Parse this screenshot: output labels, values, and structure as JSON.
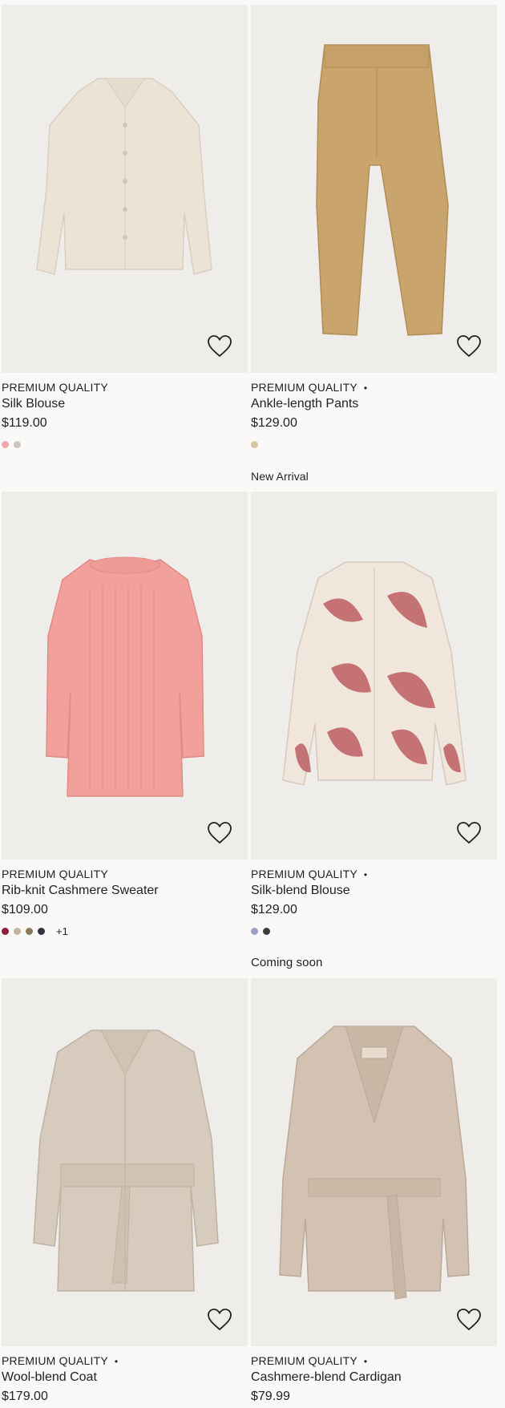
{
  "products": [
    {
      "quality": "PREMIUM QUALITY",
      "show_dot": false,
      "name": "Silk Blouse",
      "price": "$119.00",
      "colors": [
        "#f4a6ab",
        "#c9c6bd"
      ],
      "more": "",
      "badge_above": "",
      "image": "cream-blouse",
      "heart": "heart-outline-icon"
    },
    {
      "quality": "PREMIUM QUALITY",
      "show_dot": true,
      "name": "Ankle-length Pants",
      "price": "$129.00",
      "colors": [
        "#d9c4a0"
      ],
      "more": "",
      "badge_above": "",
      "image": "camel-pants",
      "heart": "heart-outline-icon"
    },
    {
      "quality": "PREMIUM QUALITY",
      "show_dot": false,
      "name": "Rib-knit Cashmere Sweater",
      "price": "$109.00",
      "colors": [
        "#8a1f3a",
        "#c5b69a",
        "#8b7a5c",
        "#2f3340"
      ],
      "more": "+1",
      "badge_above": "",
      "image": "pink-sweater",
      "heart": "heart-outline-icon"
    },
    {
      "quality": "PREMIUM QUALITY",
      "show_dot": true,
      "name": "Silk-blend Blouse",
      "price": "$129.00",
      "colors": [
        "#9aa0c4",
        "#3d3d3d"
      ],
      "more": "",
      "badge_above": "New Arrival",
      "image": "printed-blouse",
      "heart": "heart-outline-icon"
    },
    {
      "quality": "PREMIUM QUALITY",
      "show_dot": true,
      "name": "Wool-blend Coat",
      "price": "$179.00",
      "colors": [],
      "more": "",
      "badge_above": "",
      "image": "beige-coat",
      "heart": "heart-outline-icon"
    },
    {
      "quality": "PREMIUM QUALITY",
      "show_dot": true,
      "name": "Cashmere-blend Cardigan",
      "price": "$79.99",
      "colors": [],
      "more": "",
      "badge_above": "Coming soon",
      "image": "beige-cardigan",
      "heart": "heart-outline-icon"
    }
  ],
  "dot_char": "•"
}
